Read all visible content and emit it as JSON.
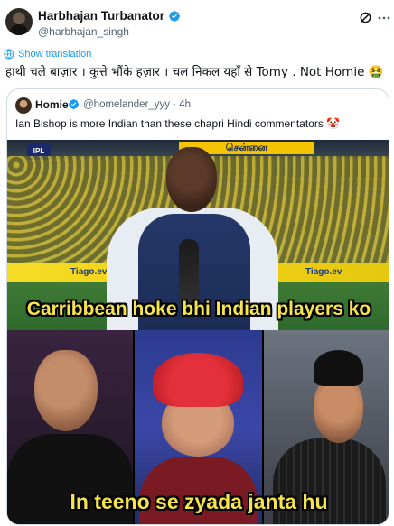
{
  "author": {
    "name": "Harbhajan Turbanator",
    "handle": "@harbhajan_singh"
  },
  "show_translation": "Show translation",
  "tweet_text": "हाथी चले बाज़ार । कुत्ते भौंके हज़ार । चल निकल यहाँ से Tomy . Not Homie 🤮",
  "quoted": {
    "name": "Homie",
    "handle_time": "@homelander_yyy · 4h",
    "text": "Ian Bishop is more Indian than these chapri Hindi commentators 🤡"
  },
  "meme": {
    "board_text": "சென்னை",
    "ipl_text": "IPL",
    "ad_left": "Tiago.ev",
    "ad_right": "Tiago.ev",
    "caption_top": "Carribbean hoke bhi Indian players ko",
    "caption_bottom": "In teeno se zyada janta hu"
  },
  "colors": {
    "link": "#1d9bf0",
    "verified": "#1d9bf0",
    "caption": "#f7e44a"
  },
  "icons": {
    "verified": "verified-badge-icon",
    "grok": "grok-icon",
    "more": "more-icon",
    "translate": "translate-icon"
  }
}
